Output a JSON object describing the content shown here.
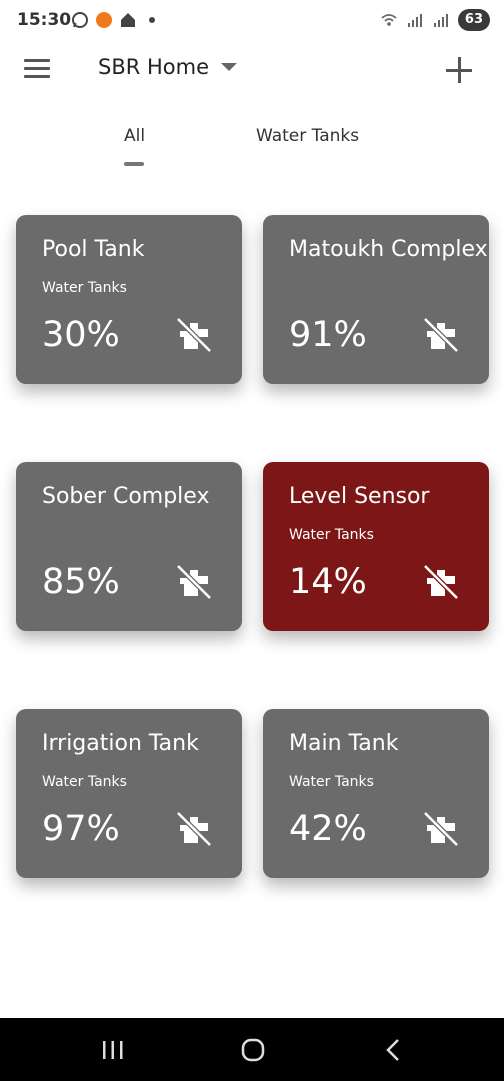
{
  "status_bar": {
    "time": "15:30",
    "notification_icons": [
      "whatsapp-icon",
      "mail-app-icon",
      "home-app-icon"
    ],
    "battery": "63"
  },
  "app_bar": {
    "home_name": "SBR Home",
    "menu_icon": "menu-icon",
    "add_icon": "add-icon"
  },
  "tabs": [
    {
      "label": "All",
      "selected": true
    },
    {
      "label": "Water Tanks",
      "selected": false
    }
  ],
  "colors": {
    "card_normal": "#6b6b6b",
    "card_alert": "#7d1717",
    "text": "#ffffff"
  },
  "devices": [
    {
      "name": "Pool Tank",
      "category": "Water Tanks",
      "level": "30%",
      "status_icon": "offline-device-icon",
      "alert": false
    },
    {
      "name": "Matoukh Complex",
      "category": "",
      "level": "91%",
      "status_icon": "offline-device-icon",
      "alert": false
    },
    {
      "name": "Sober Complex",
      "category": "",
      "level": "85%",
      "status_icon": "offline-device-icon",
      "alert": false
    },
    {
      "name": "Level Sensor",
      "category": "Water Tanks",
      "level": "14%",
      "status_icon": "offline-device-icon",
      "alert": true
    },
    {
      "name": "Irrigation Tank",
      "category": "Water Tanks",
      "level": "97%",
      "status_icon": "offline-device-icon",
      "alert": false
    },
    {
      "name": "Main Tank",
      "category": "Water Tanks",
      "level": "42%",
      "status_icon": "offline-device-icon",
      "alert": false
    }
  ],
  "nav_bar": {
    "buttons": [
      "recent-apps-icon",
      "home-icon",
      "back-icon"
    ]
  }
}
